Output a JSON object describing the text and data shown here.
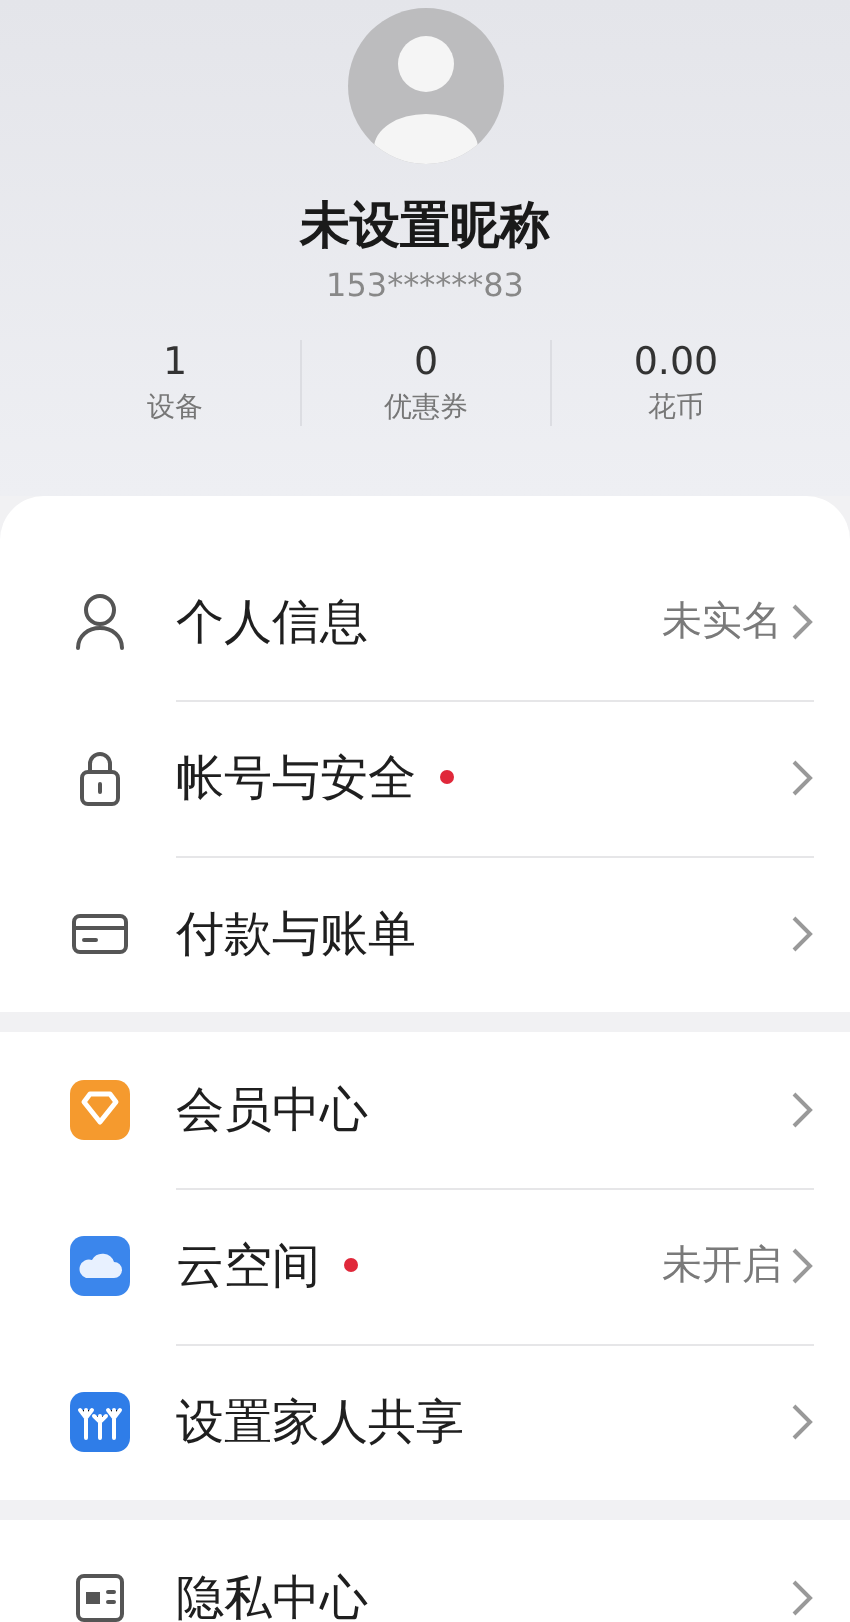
{
  "profile": {
    "name": "未设置昵称",
    "phone": "153******83"
  },
  "stats": [
    {
      "value": "1",
      "label": "设备"
    },
    {
      "value": "0",
      "label": "优惠券"
    },
    {
      "value": "0.00",
      "label": "花币"
    }
  ],
  "groups": [
    {
      "items": [
        {
          "label": "个人信息",
          "value": "未实名",
          "dot": false
        },
        {
          "label": "帐号与安全",
          "dot": true
        },
        {
          "label": "付款与账单",
          "dot": false
        }
      ]
    },
    {
      "items": [
        {
          "label": "会员中心",
          "dot": false
        },
        {
          "label": "云空间",
          "value": "未开启",
          "dot": true
        },
        {
          "label": "设置家人共享",
          "dot": false
        }
      ]
    },
    {
      "items": [
        {
          "label": "隐私中心",
          "dot": false
        }
      ]
    }
  ]
}
